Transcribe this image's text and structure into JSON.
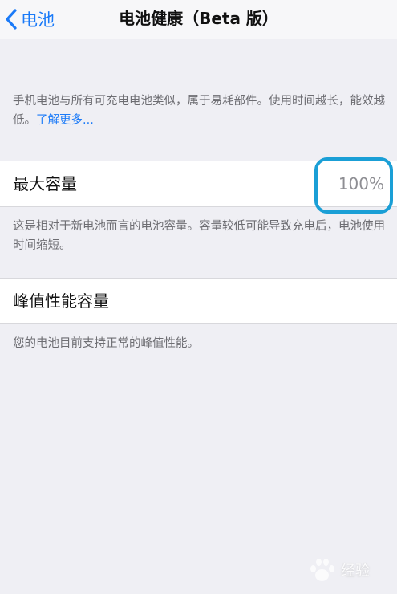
{
  "navbar": {
    "back_label": "电池",
    "title": "电池健康（Beta 版）"
  },
  "intro": {
    "text": "手机电池与所有可充电电池类似，属于易耗部件。使用时间越长，能效越低。",
    "learn_more": "了解更多..."
  },
  "max_capacity": {
    "label": "最大容量",
    "value": "100%",
    "footnote": "这是相对于新电池而言的电池容量。容量较低可能导致充电后，电池使用时间缩短。"
  },
  "peak_performance": {
    "label": "峰值性能容量",
    "footnote": "您的电池目前支持正常的峰值性能。"
  },
  "watermark": {
    "text": "经验"
  },
  "colors": {
    "accent": "#1a7af8",
    "background": "#efeff4",
    "highlight": "#1a9fd6"
  }
}
